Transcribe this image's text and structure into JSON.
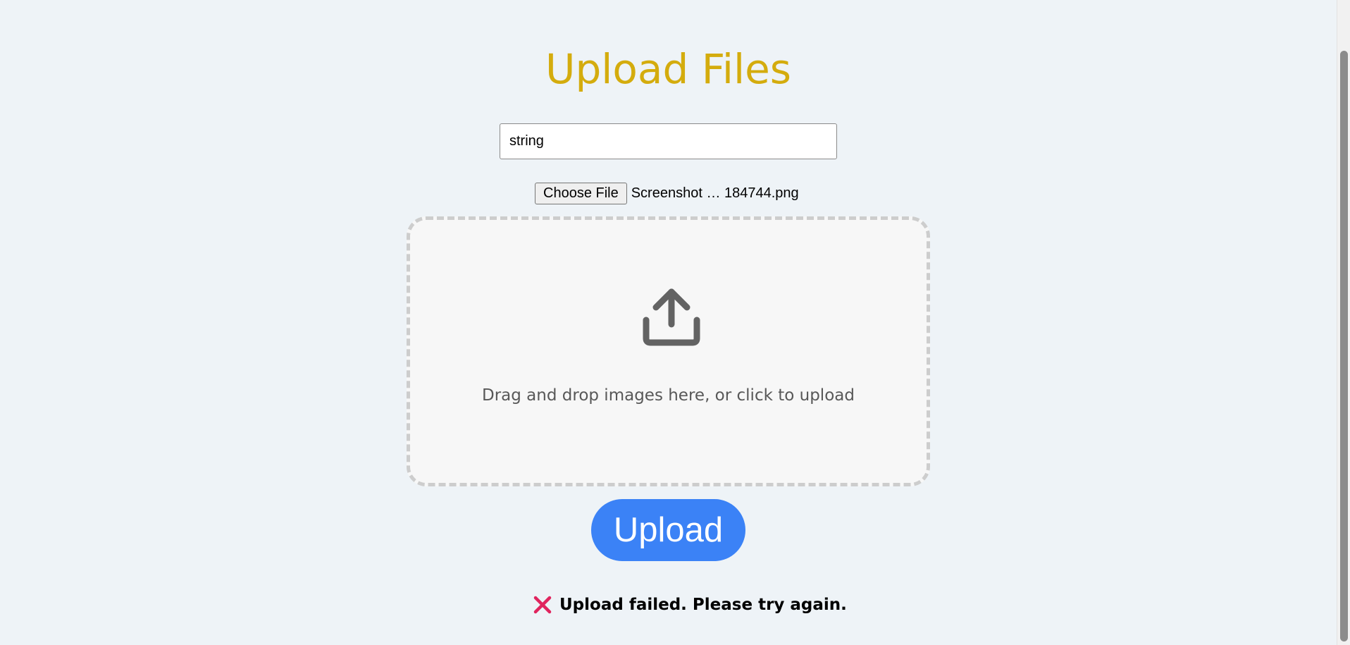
{
  "page": {
    "title": "Upload Files"
  },
  "form": {
    "text_input_value": "string",
    "choose_file_label": "Choose File",
    "selected_file_name": "Screenshot … 184744.png"
  },
  "dropzone": {
    "icon": "upload-icon",
    "text": "Drag and drop images here, or click to upload"
  },
  "actions": {
    "upload_label": "Upload"
  },
  "status": {
    "icon": "close-icon",
    "message": "Upload failed. Please try again.",
    "type": "error"
  },
  "colors": {
    "background": "#eef3f7",
    "title": "#d4ac0d",
    "primary_button": "#3b82f6",
    "error_icon": "#e0245e",
    "dropzone_border": "#cdcdcd",
    "dropzone_background": "#f7f7f7"
  }
}
